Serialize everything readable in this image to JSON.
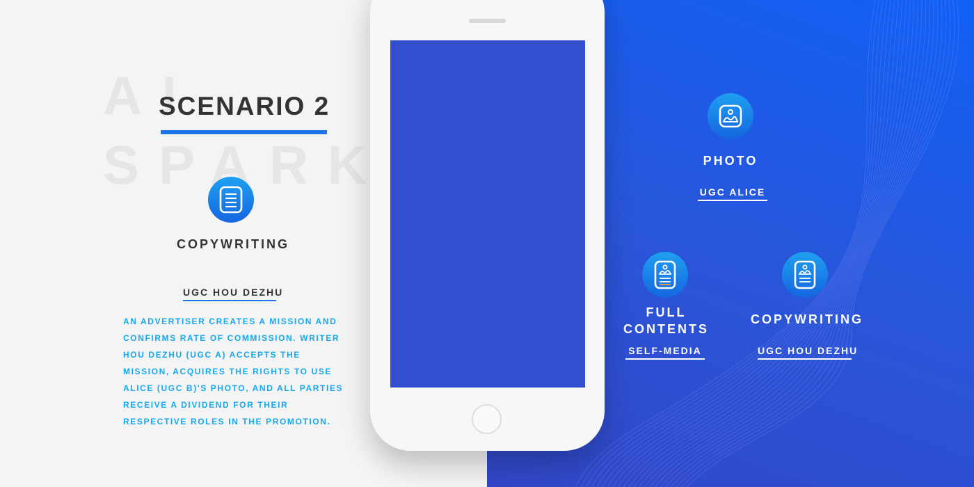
{
  "background_words": [
    "AI",
    "SPARK"
  ],
  "title": "SCENARIO 2",
  "left": {
    "icon": "document-icon",
    "label": "COPYWRITING",
    "link": "UGC HOU DEZHU",
    "description": "AN ADVERTISER CREATES A MISSION AND CONFIRMS RATE OF COMMISSION. WRITER HOU DEZHU (UGC A) ACCEPTS THE MISSION, ACQUIRES THE RIGHTS TO USE ALICE (UGC B)'S PHOTO, AND ALL PARTIES RECEIVE A DIVIDEND FOR THEIR RESPECTIVE ROLES IN THE PROMOTION."
  },
  "right": {
    "photo": {
      "icon": "photo-icon",
      "label": "PHOTO",
      "link": "UGC ALICE"
    },
    "full_contents": {
      "icon": "photo-document-icon",
      "label_line1": "FULL",
      "label_line2": "CONTENTS",
      "link": "SELF-MEDIA"
    },
    "copywriting": {
      "icon": "photo-document-icon",
      "label": "COPYWRITING",
      "link": "UGC HOU DEZHU"
    }
  },
  "colors": {
    "accent": "#1a73e8",
    "description_text": "#14a8ee",
    "right_panel": "#1a5ce6",
    "phone_screen": "#334ecf"
  }
}
